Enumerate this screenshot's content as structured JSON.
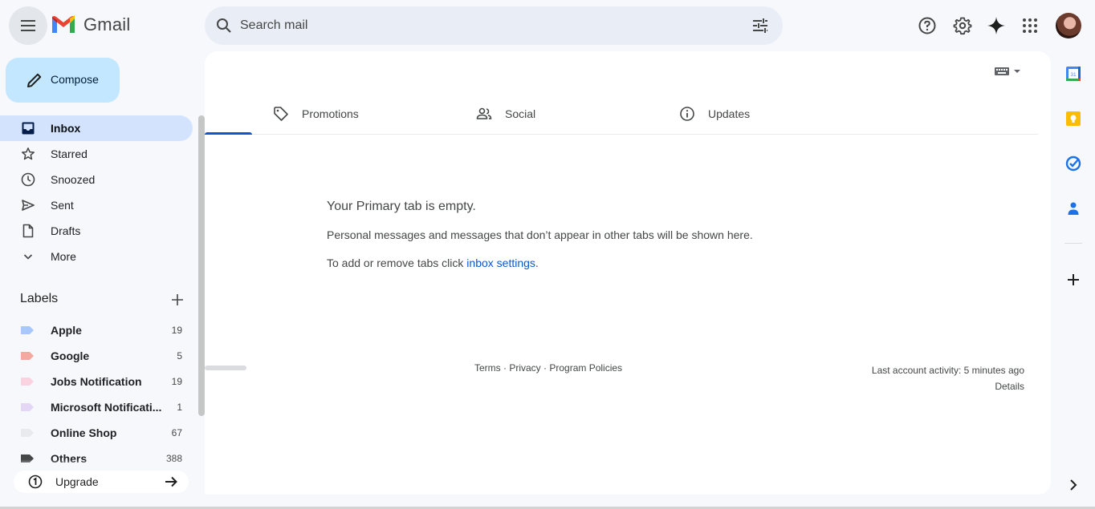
{
  "header": {
    "app_name": "Gmail",
    "search_placeholder": "Search mail",
    "icons": [
      "menu-icon",
      "search-icon",
      "tune-icon",
      "help-icon",
      "settings-icon",
      "gemini-icon",
      "apps-icon",
      "avatar"
    ]
  },
  "sidebar": {
    "compose_label": "Compose",
    "items": [
      {
        "label": "Inbox",
        "icon": "inbox-icon",
        "active": true
      },
      {
        "label": "Starred",
        "icon": "star-icon"
      },
      {
        "label": "Snoozed",
        "icon": "clock-icon"
      },
      {
        "label": "Sent",
        "icon": "send-icon"
      },
      {
        "label": "Drafts",
        "icon": "draft-icon"
      },
      {
        "label": "More",
        "icon": "chevron-down-icon"
      }
    ],
    "labels_title": "Labels",
    "labels": [
      {
        "name": "Apple",
        "count": "19",
        "color": "#a8c7fa"
      },
      {
        "name": "Google",
        "count": "5",
        "color": "#f3a99f"
      },
      {
        "name": "Jobs Notification",
        "count": "19",
        "color": "#fbd3e0"
      },
      {
        "name": "Microsoft Notificati...",
        "count": "1",
        "color": "#e4d7f5"
      },
      {
        "name": "Online Shop",
        "count": "67",
        "color": "#e8eaed"
      },
      {
        "name": "Others",
        "count": "388",
        "color": "#444746"
      }
    ],
    "upgrade_label": "Upgrade"
  },
  "tabs": [
    {
      "label": "Promotions",
      "icon": "tag-icon"
    },
    {
      "label": "Social",
      "icon": "people-icon"
    },
    {
      "label": "Updates",
      "icon": "info-icon"
    }
  ],
  "empty_state": {
    "heading": "Your Primary tab is empty.",
    "line1": "Personal messages and messages that don’t appear in other tabs will be shown here.",
    "line2_prefix": "To add or remove tabs click ",
    "line2_link": "inbox settings",
    "line2_suffix": "."
  },
  "footer": {
    "terms": "Terms",
    "privacy": "Privacy",
    "policies": "Program Policies",
    "separator": " · ",
    "activity": "Last account activity: 5 minutes ago",
    "details": "Details"
  },
  "right_rail": [
    "calendar-icon",
    "keep-icon",
    "tasks-icon",
    "contacts-icon",
    "add-icon",
    "expand-icon"
  ],
  "colors": {
    "accent": "#0b57d0",
    "compose_bg": "#c2e7ff",
    "active_nav": "#d3e3fd"
  }
}
